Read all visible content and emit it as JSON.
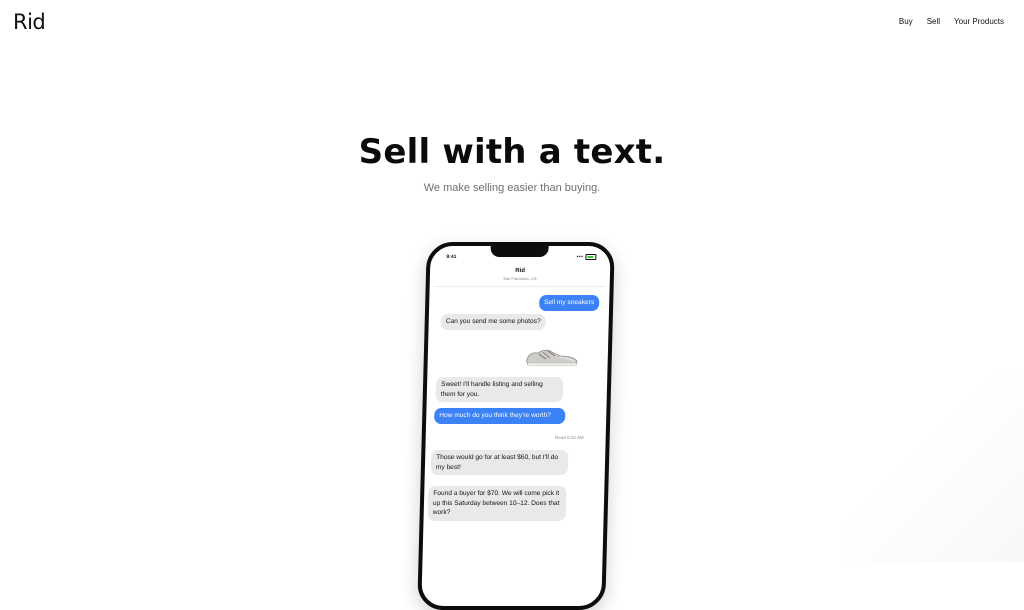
{
  "header": {
    "logo": "Rid",
    "nav": [
      "Buy",
      "Sell",
      "Your Products"
    ]
  },
  "hero": {
    "title": "Sell with a text.",
    "subtitle": "We make selling easier than buying."
  },
  "phone": {
    "status_time": "9:41",
    "contact_name": "Rid",
    "contact_location": "San Francisco, CA",
    "messages": [
      {
        "from": "me",
        "text": "Sell my sneakers"
      },
      {
        "from": "them",
        "text": "Can you send me some photos?"
      },
      {
        "from": "me",
        "type": "image",
        "icon": "sneaker-photo"
      },
      {
        "from": "them",
        "text": "Sweet! I'll handle listing and selling them for you."
      },
      {
        "from": "me",
        "text": "How much do you think they're worth?"
      },
      {
        "from": "them",
        "text": "Those would go for at least $60, but I'll do my best!"
      },
      {
        "from": "them",
        "text": "Found a buyer for $70. We will come pick it up this Saturday between 10–12. Does that work?"
      }
    ],
    "read_receipt": "Read 6:42 AM"
  },
  "colors": {
    "outgoing_bubble": "#3b82f6",
    "incoming_bubble": "#e9e9eb"
  }
}
